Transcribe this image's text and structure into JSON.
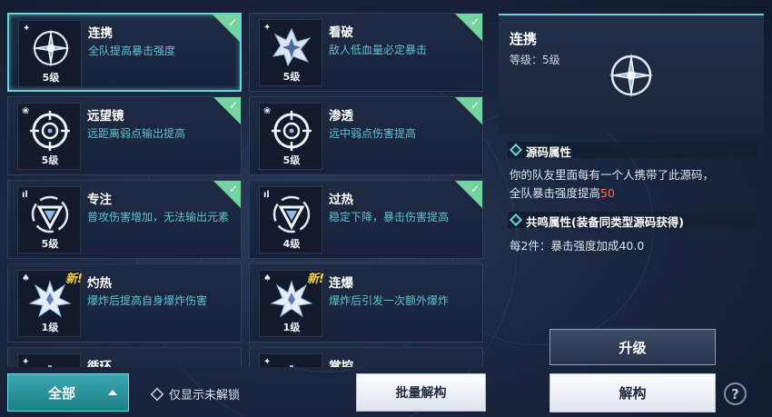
{
  "cards": [
    {
      "name": "连携",
      "desc": "全队提高暴击强度",
      "level": "5级",
      "rank": "✦",
      "new": "",
      "icon": "compass-star-icon",
      "unlocked": true
    },
    {
      "name": "看破",
      "desc": "敌人低血量必定暴击",
      "level": "5级",
      "rank": "✦",
      "new": "",
      "icon": "crack-burst-icon",
      "unlocked": true
    },
    {
      "name": "远望镜",
      "desc": "远距离弱点输出提高",
      "level": "5级",
      "rank": "❀",
      "new": "",
      "icon": "crosshair-icon",
      "unlocked": true
    },
    {
      "name": "渗透",
      "desc": "远中弱点伤害提高",
      "level": "5级",
      "rank": "❀",
      "new": "",
      "icon": "crosshair-icon",
      "unlocked": true
    },
    {
      "name": "专注",
      "desc": "普攻伤害增加，无法输出元素",
      "level": "5级",
      "rank": "ıl",
      "new": "",
      "icon": "triangle-target-icon",
      "unlocked": true
    },
    {
      "name": "过热",
      "desc": "稳定下降，暴击伤害提高",
      "level": "4级",
      "rank": "ıl",
      "new": "",
      "icon": "triangle-target-icon",
      "unlocked": true
    },
    {
      "name": "灼热",
      "desc": "爆炸后提高自身爆炸伤害",
      "level": "1级",
      "rank": "♠",
      "new": "新!",
      "icon": "explosion-icon",
      "unlocked": false
    },
    {
      "name": "连爆",
      "desc": "爆炸后引发一次额外爆炸",
      "level": "1级",
      "rank": "♠",
      "new": "新!",
      "icon": "explosion-icon",
      "unlocked": false
    },
    {
      "name": "循环",
      "desc": "",
      "level": "",
      "rank": "✦",
      "new": "",
      "icon": "cycle-icon",
      "unlocked": false
    },
    {
      "name": "掌控",
      "desc": "",
      "level": "",
      "rank": "✦",
      "new": "",
      "icon": "control-icon",
      "unlocked": false
    }
  ],
  "detail": {
    "title": "连携",
    "level": "等级：5级",
    "source_section": "源码属性",
    "source_text": "你的队友里面每有一个人携带了此源码，",
    "source_text2_prefix": "全队暴击强度提高",
    "source_text2_value": "50",
    "resonance_section": "共鸣属性(装备同类型源码获得)",
    "resonance_text": "每2件：暴击强度加成40.0"
  },
  "buttons": {
    "upgrade": "升级",
    "deconstruct": "解构",
    "bulk": "批量解构",
    "filter": "全部",
    "toggle": "仅显示未解锁",
    "help": "?"
  },
  "colors": {
    "accent": "#63d6dc",
    "check": "#74d3a0",
    "desc": "#5fc2d2",
    "new_tag": "#f5d04a",
    "highlight": "#ff6b3d"
  }
}
